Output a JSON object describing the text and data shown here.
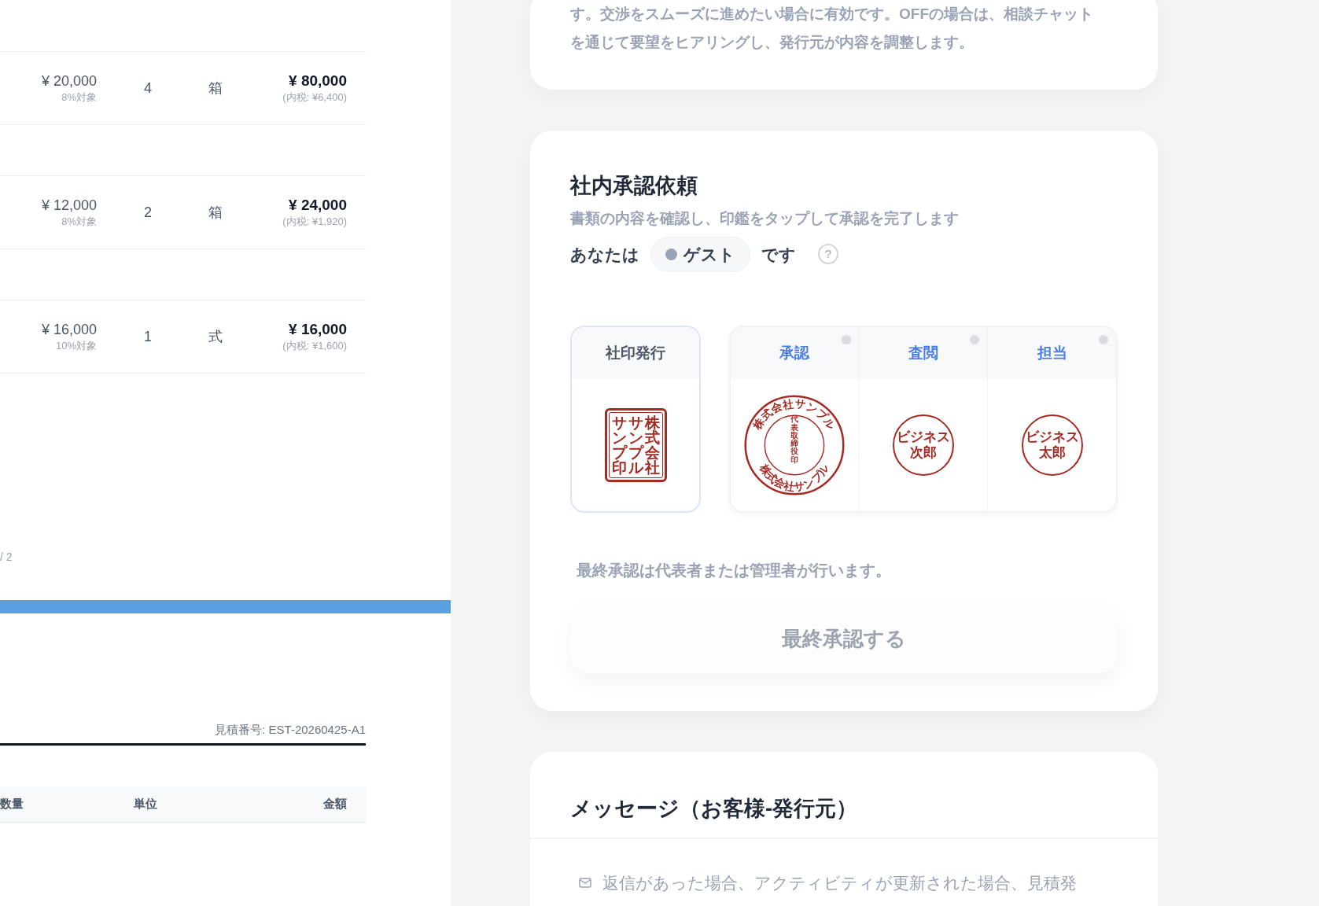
{
  "estimate": {
    "rows": [
      {
        "unit_price": "¥ 20,000",
        "tax_rate": "8%対象",
        "quantity": "4",
        "unit": "箱",
        "amount": "¥ 80,000",
        "tax_included": "(内税: ¥6,400)"
      },
      {
        "unit_price": "¥ 12,000",
        "tax_rate": "8%対象",
        "quantity": "2",
        "unit": "箱",
        "amount": "¥ 24,000",
        "tax_included": "(内税: ¥1,920)"
      },
      {
        "unit_price": "¥ 16,000",
        "tax_rate": "10%対象",
        "quantity": "1",
        "unit": "式",
        "amount": "¥ 16,000",
        "tax_included": "(内税: ¥1,600)"
      }
    ],
    "page_indicator": "/ 2",
    "progress": {
      "level": 1
    },
    "estimate_number": "見積番号: EST-20260425-A1",
    "columns": [
      "数量",
      "単位",
      "金額"
    ]
  },
  "negotiation_card": {
    "description": "す。交渉をスムーズに進めたい場合に有効です。OFFの場合は、相談チャットを通じて要望をヒアリングし、発行元が内容を調整します。"
  },
  "approval_card": {
    "title": "社内承認依頼",
    "subtitle": "書類の内容を確認し、印鑑をタップして承認を完了します",
    "role_prefix": "あなたは",
    "role": "ゲスト",
    "role_suffix": "です",
    "help": "?",
    "company_seal": {
      "label": "社印発行",
      "columns": [
        "サンプ印",
        "サンプル",
        "株式会社"
      ]
    },
    "approvers": [
      {
        "label": "承認",
        "kind": "round",
        "approved": false,
        "ring_top": "株式会社サンプル",
        "ring_bottom": "株式会社サンプル",
        "center": "代表取締役印"
      },
      {
        "label": "査閲",
        "kind": "name",
        "approved": false,
        "lines": [
          "ビジネス",
          "次郎"
        ]
      },
      {
        "label": "担当",
        "kind": "name",
        "approved": false,
        "lines": [
          "ビジネス",
          "太郎"
        ]
      }
    ],
    "note": "最終承認は代表者または管理者が行います。",
    "final_button": "最終承認する"
  },
  "message_card": {
    "title": "メッセージ（お客様-発行元）",
    "notice": "返信があった場合、アクティビティが更新された場合、見積発"
  }
}
